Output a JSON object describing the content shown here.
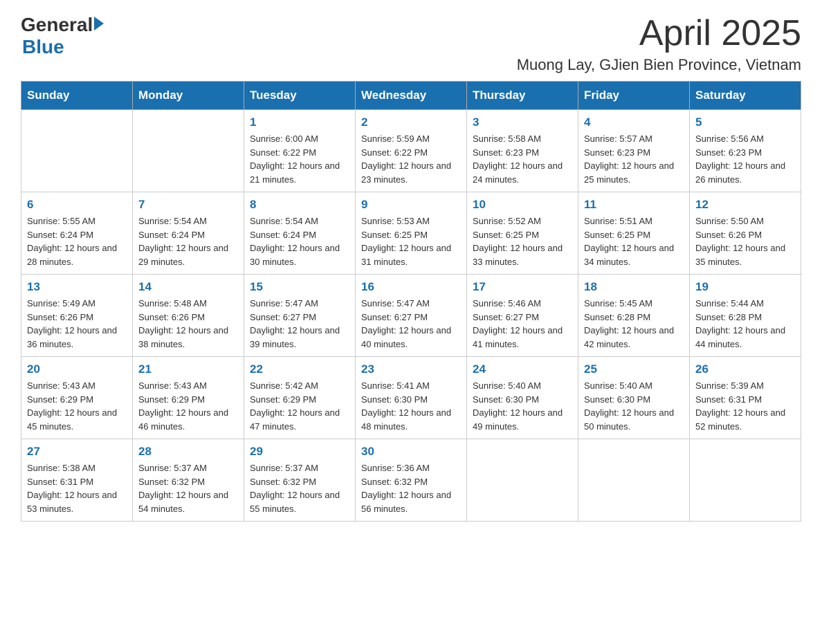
{
  "header": {
    "logo_general": "General",
    "logo_blue": "Blue",
    "title": "April 2025",
    "subtitle": "Muong Lay, GJien Bien Province, Vietnam"
  },
  "days_of_week": [
    "Sunday",
    "Monday",
    "Tuesday",
    "Wednesday",
    "Thursday",
    "Friday",
    "Saturday"
  ],
  "weeks": [
    [
      {
        "day": "",
        "sunrise": "",
        "sunset": "",
        "daylight": ""
      },
      {
        "day": "",
        "sunrise": "",
        "sunset": "",
        "daylight": ""
      },
      {
        "day": "1",
        "sunrise": "Sunrise: 6:00 AM",
        "sunset": "Sunset: 6:22 PM",
        "daylight": "Daylight: 12 hours and 21 minutes."
      },
      {
        "day": "2",
        "sunrise": "Sunrise: 5:59 AM",
        "sunset": "Sunset: 6:22 PM",
        "daylight": "Daylight: 12 hours and 23 minutes."
      },
      {
        "day": "3",
        "sunrise": "Sunrise: 5:58 AM",
        "sunset": "Sunset: 6:23 PM",
        "daylight": "Daylight: 12 hours and 24 minutes."
      },
      {
        "day": "4",
        "sunrise": "Sunrise: 5:57 AM",
        "sunset": "Sunset: 6:23 PM",
        "daylight": "Daylight: 12 hours and 25 minutes."
      },
      {
        "day": "5",
        "sunrise": "Sunrise: 5:56 AM",
        "sunset": "Sunset: 6:23 PM",
        "daylight": "Daylight: 12 hours and 26 minutes."
      }
    ],
    [
      {
        "day": "6",
        "sunrise": "Sunrise: 5:55 AM",
        "sunset": "Sunset: 6:24 PM",
        "daylight": "Daylight: 12 hours and 28 minutes."
      },
      {
        "day": "7",
        "sunrise": "Sunrise: 5:54 AM",
        "sunset": "Sunset: 6:24 PM",
        "daylight": "Daylight: 12 hours and 29 minutes."
      },
      {
        "day": "8",
        "sunrise": "Sunrise: 5:54 AM",
        "sunset": "Sunset: 6:24 PM",
        "daylight": "Daylight: 12 hours and 30 minutes."
      },
      {
        "day": "9",
        "sunrise": "Sunrise: 5:53 AM",
        "sunset": "Sunset: 6:25 PM",
        "daylight": "Daylight: 12 hours and 31 minutes."
      },
      {
        "day": "10",
        "sunrise": "Sunrise: 5:52 AM",
        "sunset": "Sunset: 6:25 PM",
        "daylight": "Daylight: 12 hours and 33 minutes."
      },
      {
        "day": "11",
        "sunrise": "Sunrise: 5:51 AM",
        "sunset": "Sunset: 6:25 PM",
        "daylight": "Daylight: 12 hours and 34 minutes."
      },
      {
        "day": "12",
        "sunrise": "Sunrise: 5:50 AM",
        "sunset": "Sunset: 6:26 PM",
        "daylight": "Daylight: 12 hours and 35 minutes."
      }
    ],
    [
      {
        "day": "13",
        "sunrise": "Sunrise: 5:49 AM",
        "sunset": "Sunset: 6:26 PM",
        "daylight": "Daylight: 12 hours and 36 minutes."
      },
      {
        "day": "14",
        "sunrise": "Sunrise: 5:48 AM",
        "sunset": "Sunset: 6:26 PM",
        "daylight": "Daylight: 12 hours and 38 minutes."
      },
      {
        "day": "15",
        "sunrise": "Sunrise: 5:47 AM",
        "sunset": "Sunset: 6:27 PM",
        "daylight": "Daylight: 12 hours and 39 minutes."
      },
      {
        "day": "16",
        "sunrise": "Sunrise: 5:47 AM",
        "sunset": "Sunset: 6:27 PM",
        "daylight": "Daylight: 12 hours and 40 minutes."
      },
      {
        "day": "17",
        "sunrise": "Sunrise: 5:46 AM",
        "sunset": "Sunset: 6:27 PM",
        "daylight": "Daylight: 12 hours and 41 minutes."
      },
      {
        "day": "18",
        "sunrise": "Sunrise: 5:45 AM",
        "sunset": "Sunset: 6:28 PM",
        "daylight": "Daylight: 12 hours and 42 minutes."
      },
      {
        "day": "19",
        "sunrise": "Sunrise: 5:44 AM",
        "sunset": "Sunset: 6:28 PM",
        "daylight": "Daylight: 12 hours and 44 minutes."
      }
    ],
    [
      {
        "day": "20",
        "sunrise": "Sunrise: 5:43 AM",
        "sunset": "Sunset: 6:29 PM",
        "daylight": "Daylight: 12 hours and 45 minutes."
      },
      {
        "day": "21",
        "sunrise": "Sunrise: 5:43 AM",
        "sunset": "Sunset: 6:29 PM",
        "daylight": "Daylight: 12 hours and 46 minutes."
      },
      {
        "day": "22",
        "sunrise": "Sunrise: 5:42 AM",
        "sunset": "Sunset: 6:29 PM",
        "daylight": "Daylight: 12 hours and 47 minutes."
      },
      {
        "day": "23",
        "sunrise": "Sunrise: 5:41 AM",
        "sunset": "Sunset: 6:30 PM",
        "daylight": "Daylight: 12 hours and 48 minutes."
      },
      {
        "day": "24",
        "sunrise": "Sunrise: 5:40 AM",
        "sunset": "Sunset: 6:30 PM",
        "daylight": "Daylight: 12 hours and 49 minutes."
      },
      {
        "day": "25",
        "sunrise": "Sunrise: 5:40 AM",
        "sunset": "Sunset: 6:30 PM",
        "daylight": "Daylight: 12 hours and 50 minutes."
      },
      {
        "day": "26",
        "sunrise": "Sunrise: 5:39 AM",
        "sunset": "Sunset: 6:31 PM",
        "daylight": "Daylight: 12 hours and 52 minutes."
      }
    ],
    [
      {
        "day": "27",
        "sunrise": "Sunrise: 5:38 AM",
        "sunset": "Sunset: 6:31 PM",
        "daylight": "Daylight: 12 hours and 53 minutes."
      },
      {
        "day": "28",
        "sunrise": "Sunrise: 5:37 AM",
        "sunset": "Sunset: 6:32 PM",
        "daylight": "Daylight: 12 hours and 54 minutes."
      },
      {
        "day": "29",
        "sunrise": "Sunrise: 5:37 AM",
        "sunset": "Sunset: 6:32 PM",
        "daylight": "Daylight: 12 hours and 55 minutes."
      },
      {
        "day": "30",
        "sunrise": "Sunrise: 5:36 AM",
        "sunset": "Sunset: 6:32 PM",
        "daylight": "Daylight: 12 hours and 56 minutes."
      },
      {
        "day": "",
        "sunrise": "",
        "sunset": "",
        "daylight": ""
      },
      {
        "day": "",
        "sunrise": "",
        "sunset": "",
        "daylight": ""
      },
      {
        "day": "",
        "sunrise": "",
        "sunset": "",
        "daylight": ""
      }
    ]
  ]
}
